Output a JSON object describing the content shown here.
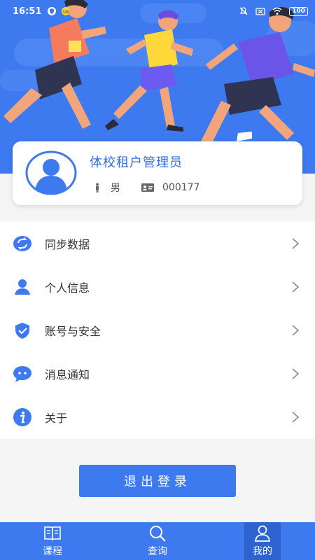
{
  "status_bar": {
    "time": "16:51",
    "battery": "100"
  },
  "profile": {
    "name": "体校租户管理员",
    "gender": "男",
    "id_number": "000177"
  },
  "menu": {
    "items": [
      {
        "label": "同步数据",
        "icon": "sync-icon"
      },
      {
        "label": "个人信息",
        "icon": "user-icon"
      },
      {
        "label": "账号与安全",
        "icon": "shield-icon"
      },
      {
        "label": "消息通知",
        "icon": "message-icon"
      },
      {
        "label": "关于",
        "icon": "info-icon"
      }
    ]
  },
  "logout": {
    "label": "退出登录"
  },
  "tabbar": {
    "tabs": [
      {
        "label": "课程",
        "icon": "book-icon"
      },
      {
        "label": "查询",
        "icon": "search-icon"
      },
      {
        "label": "我的",
        "icon": "person-icon",
        "active": true
      }
    ]
  },
  "colors": {
    "primary": "#3d7af0",
    "active_tab": "#2d62d0",
    "name_text": "#2f6fe6"
  }
}
